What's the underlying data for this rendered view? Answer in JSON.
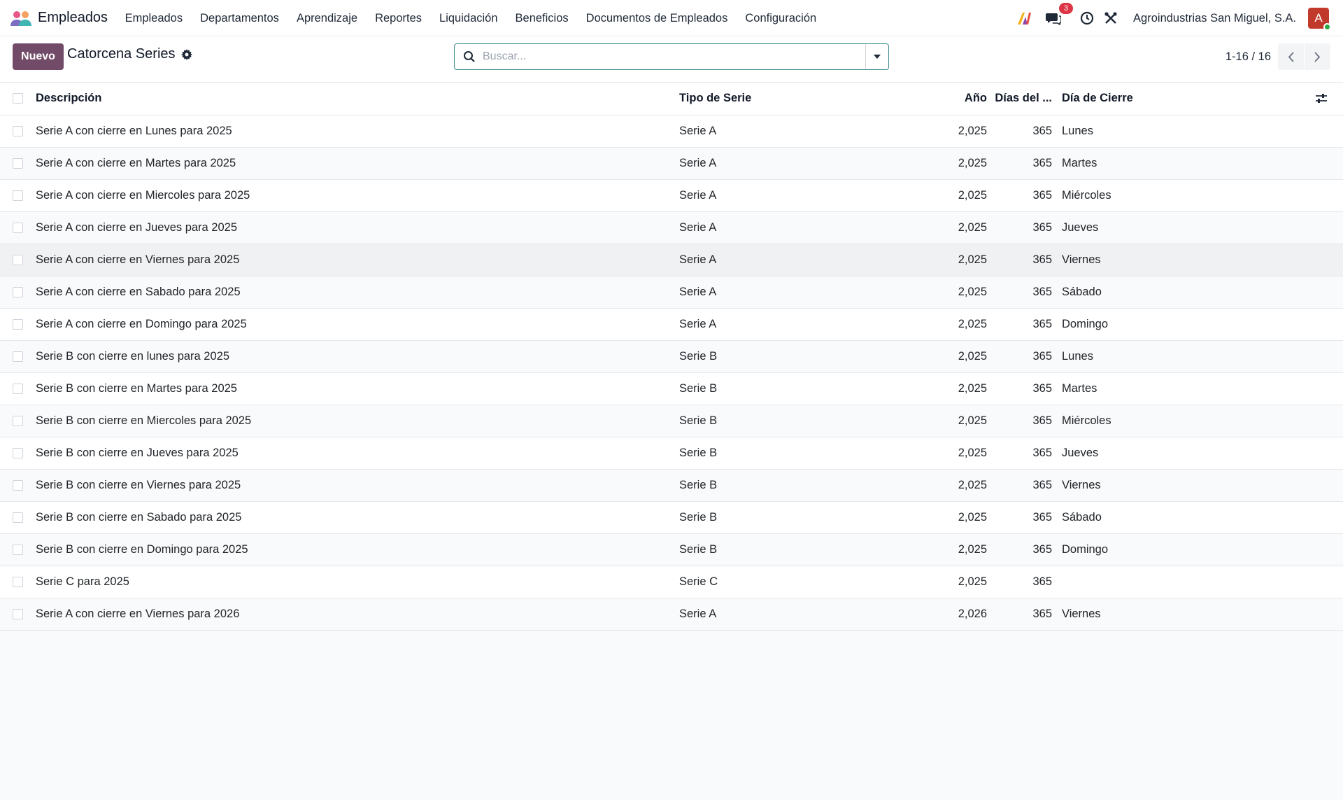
{
  "navbar": {
    "app_name": "Empleados",
    "menu": [
      "Empleados",
      "Departamentos",
      "Aprendizaje",
      "Reportes",
      "Liquidación",
      "Beneficios",
      "Documentos de Empleados",
      "Configuración"
    ],
    "messages_badge": "3",
    "company": "Agroindustrias San Miguel, S.A.",
    "avatar_letter": "A"
  },
  "control": {
    "new_label": "Nuevo",
    "title": "Catorcena Series",
    "search_placeholder": "Buscar...",
    "pager": "1-16 / 16"
  },
  "table": {
    "headers": {
      "descripcion": "Descripción",
      "tipo": "Tipo de Serie",
      "anio": "Año",
      "dias": "Días del ...",
      "cierre": "Día de Cierre"
    },
    "rows": [
      {
        "descripcion": "Serie A con cierre en Lunes para 2025",
        "tipo": "Serie A",
        "anio": "2,025",
        "dias": "365",
        "cierre": "Lunes"
      },
      {
        "descripcion": "Serie A con cierre en Martes para 2025",
        "tipo": "Serie A",
        "anio": "2,025",
        "dias": "365",
        "cierre": "Martes"
      },
      {
        "descripcion": "Serie A con cierre en Miercoles para 2025",
        "tipo": "Serie A",
        "anio": "2,025",
        "dias": "365",
        "cierre": "Miércoles"
      },
      {
        "descripcion": "Serie A con cierre en Jueves para 2025",
        "tipo": "Serie A",
        "anio": "2,025",
        "dias": "365",
        "cierre": "Jueves"
      },
      {
        "descripcion": "Serie A con cierre en Viernes para 2025",
        "tipo": "Serie A",
        "anio": "2,025",
        "dias": "365",
        "cierre": "Viernes"
      },
      {
        "descripcion": "Serie A con cierre en Sabado para 2025",
        "tipo": "Serie A",
        "anio": "2,025",
        "dias": "365",
        "cierre": "Sábado"
      },
      {
        "descripcion": "Serie A con cierre en Domingo para 2025",
        "tipo": "Serie A",
        "anio": "2,025",
        "dias": "365",
        "cierre": "Domingo"
      },
      {
        "descripcion": "Serie B con cierre en lunes para 2025",
        "tipo": "Serie B",
        "anio": "2,025",
        "dias": "365",
        "cierre": "Lunes"
      },
      {
        "descripcion": "Serie B con cierre en Martes para 2025",
        "tipo": "Serie B",
        "anio": "2,025",
        "dias": "365",
        "cierre": "Martes"
      },
      {
        "descripcion": "Serie B con cierre en Miercoles para 2025",
        "tipo": "Serie B",
        "anio": "2,025",
        "dias": "365",
        "cierre": "Miércoles"
      },
      {
        "descripcion": "Serie B con cierre en Jueves para 2025",
        "tipo": "Serie B",
        "anio": "2,025",
        "dias": "365",
        "cierre": "Jueves"
      },
      {
        "descripcion": "Serie B con cierre en Viernes para 2025",
        "tipo": "Serie B",
        "anio": "2,025",
        "dias": "365",
        "cierre": "Viernes"
      },
      {
        "descripcion": "Serie B con cierre en Sabado para 2025",
        "tipo": "Serie B",
        "anio": "2,025",
        "dias": "365",
        "cierre": "Sábado"
      },
      {
        "descripcion": "Serie B con cierre en Domingo para 2025",
        "tipo": "Serie B",
        "anio": "2,025",
        "dias": "365",
        "cierre": "Domingo"
      },
      {
        "descripcion": "Serie C para 2025",
        "tipo": "Serie C",
        "anio": "2,025",
        "dias": "365",
        "cierre": ""
      },
      {
        "descripcion": "Serie A con cierre en Viernes para 2026",
        "tipo": "Serie A",
        "anio": "2,026",
        "dias": "365",
        "cierre": "Viernes"
      }
    ]
  },
  "colors": {
    "brand": "#714b67",
    "search_border": "#3d8c8c",
    "badge": "#dc3545",
    "avatar": "#c0392b"
  }
}
